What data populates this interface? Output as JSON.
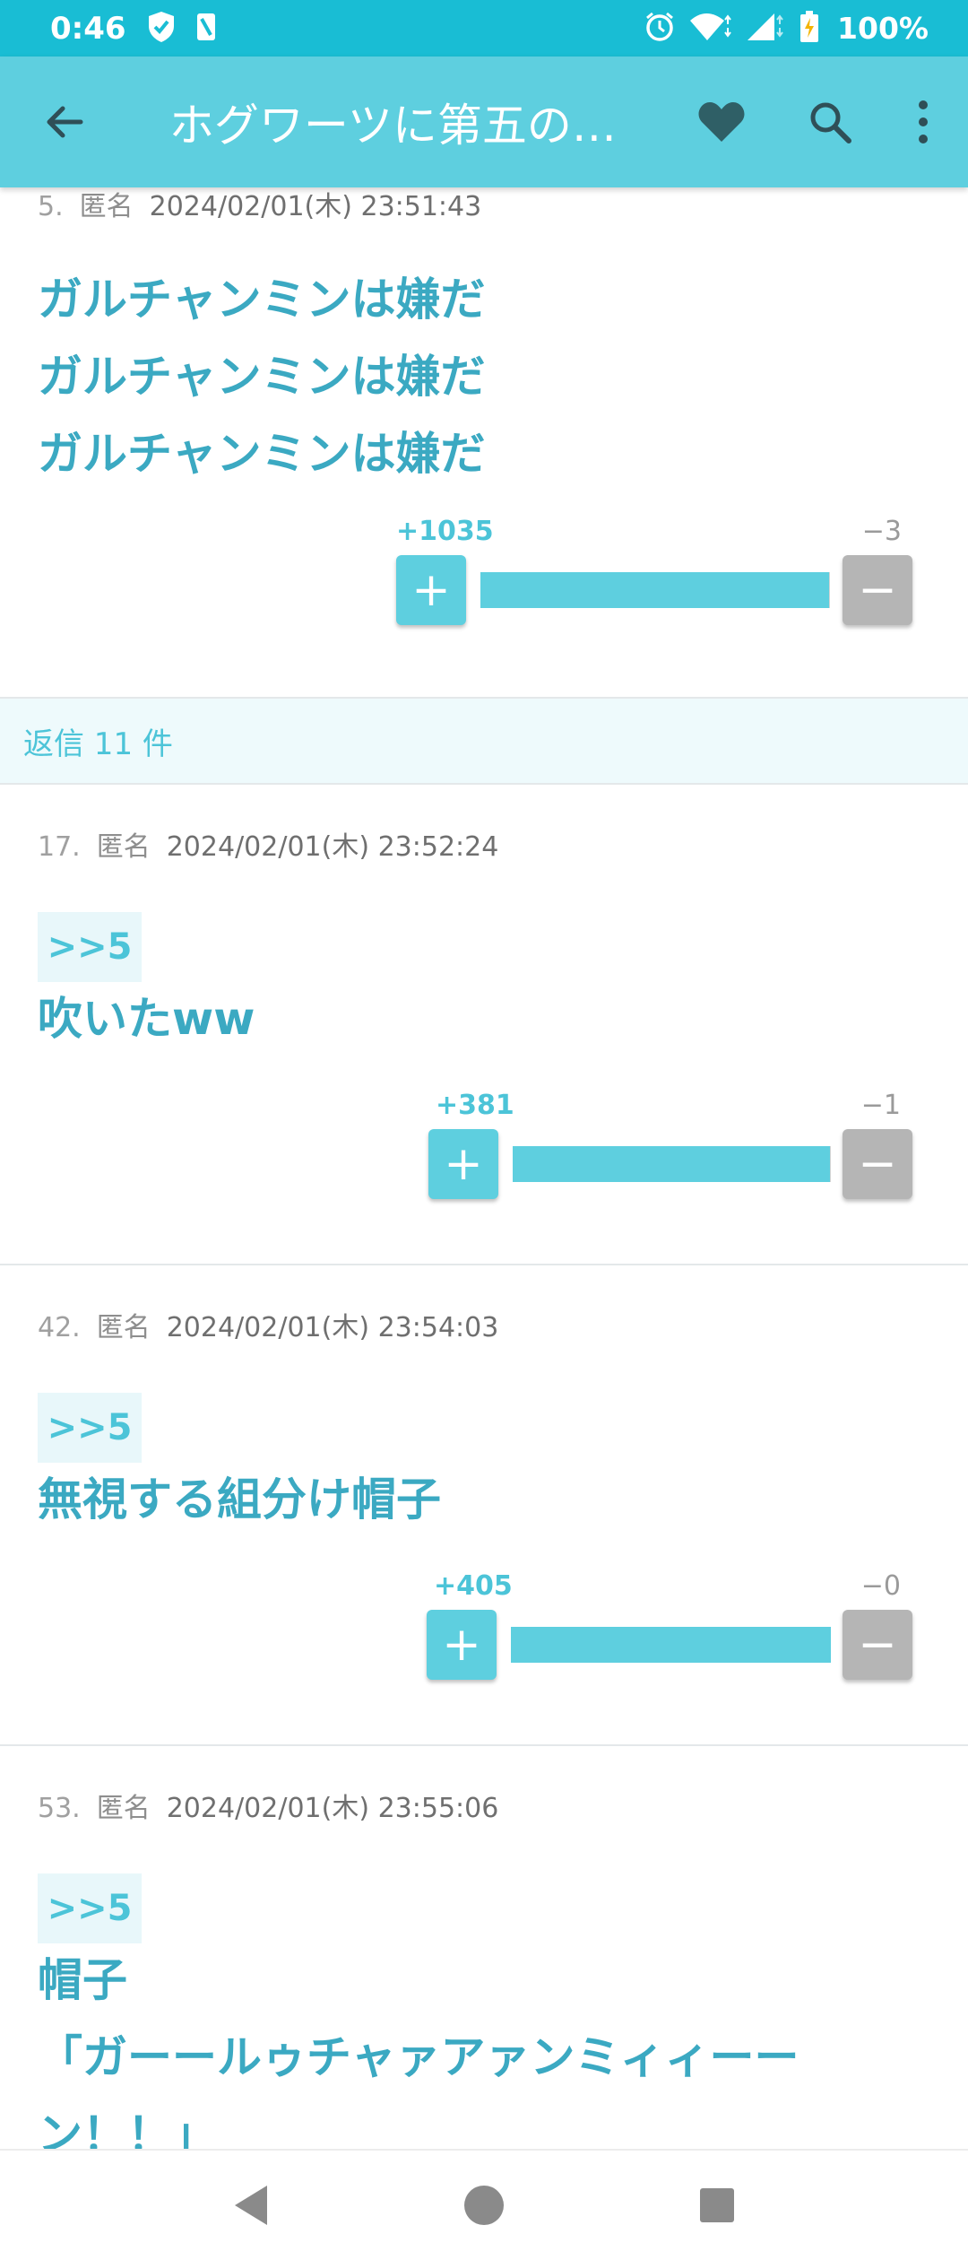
{
  "status_bar": {
    "time": "0:46",
    "battery": "100%",
    "icons": [
      "shield-icon",
      "sim-icon",
      "alarm-icon",
      "wifi-icon",
      "signal-icon",
      "battery-icon"
    ]
  },
  "app_bar": {
    "title": "ホグワーツに第五の…",
    "icons": [
      "arrow-back-icon",
      "heart-icon",
      "search-icon",
      "more-vert-icon"
    ]
  },
  "colors": {
    "accent": "#5ecfdf",
    "status_bar": "#19bdd4",
    "post_text": "#3ba9c2",
    "minus": "#b5b5b5"
  },
  "main_post": {
    "number": "5.",
    "name": "匿名",
    "date": "2024/02/01(木) 23:51:43",
    "body": "ガルチャンミンは嫌だ\nガルチャンミンは嫌だ\nガルチャンミンは嫌だ",
    "plus": "+1035",
    "minus": "−3",
    "plus_value": 1035,
    "minus_value": 3
  },
  "replies_header": "返信 11 件",
  "replies": [
    {
      "number": "17.",
      "name": "匿名",
      "date": "2024/02/01(木) 23:52:24",
      "anchor": ">>5",
      "body": "吹いたww",
      "plus": "+381",
      "minus": "−1",
      "plus_value": 381,
      "minus_value": 1
    },
    {
      "number": "42.",
      "name": "匿名",
      "date": "2024/02/01(木) 23:54:03",
      "anchor": ">>5",
      "body": "無視する組分け帽子",
      "plus": "+405",
      "minus": "−0",
      "plus_value": 405,
      "minus_value": 0
    },
    {
      "number": "53.",
      "name": "匿名",
      "date": "2024/02/01(木) 23:55:06",
      "anchor": ">>5",
      "body": "帽子\n「ガーールゥチャァアァンミィィーー\nン！！」"
    }
  ],
  "nav_bar": {
    "icons": [
      "back-triangle-icon",
      "home-circle-icon",
      "recents-square-icon"
    ]
  }
}
